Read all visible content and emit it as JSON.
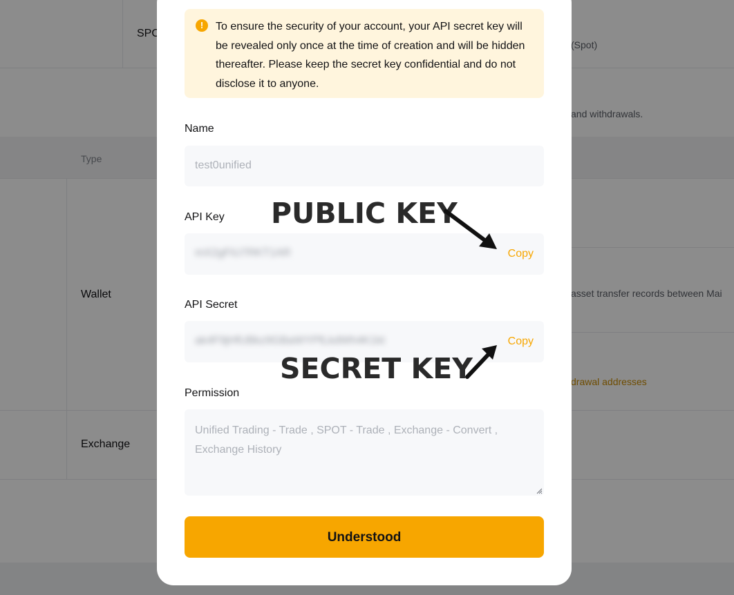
{
  "background": {
    "spot_label": "SPO",
    "spot_right": "(Spot)",
    "desc_right": "and withdrawals.",
    "table_header_type": "Type",
    "wallet_label": "Wallet",
    "transfer_text": "asset transfer records between Mai",
    "withdraw_link": "drawal addresses",
    "exchange_label": "Exchange"
  },
  "modal": {
    "notice_icon_glyph": "!",
    "notice_text": "To ensure the security of your account, your API secret key will be revealed only once at the time of creation and will be hidden thereafter. Please keep the secret key confidential and do not disclose it to anyone.",
    "name": {
      "label": "Name",
      "value": "test0unified"
    },
    "api_key": {
      "label": "API Key",
      "value": "mX2gFiU7RKT1AR",
      "copy_label": "Copy"
    },
    "api_secret": {
      "label": "API Secret",
      "value": "ak4F9jHfUBkz9GBaWYPfLkdWh4K1kt",
      "copy_label": "Copy"
    },
    "permission": {
      "label": "Permission",
      "value": "Unified Trading - Trade  , SPOT - Trade  , Exchange - Convert , Exchange History"
    },
    "confirm_button": "Understood"
  },
  "annotations": {
    "public_key": "PUBLIC KEY",
    "secret_key": "SECRET KEY"
  },
  "colors": {
    "accent": "#f7a600",
    "notice_bg": "#fff5dd",
    "field_bg": "#f7f8fa"
  }
}
